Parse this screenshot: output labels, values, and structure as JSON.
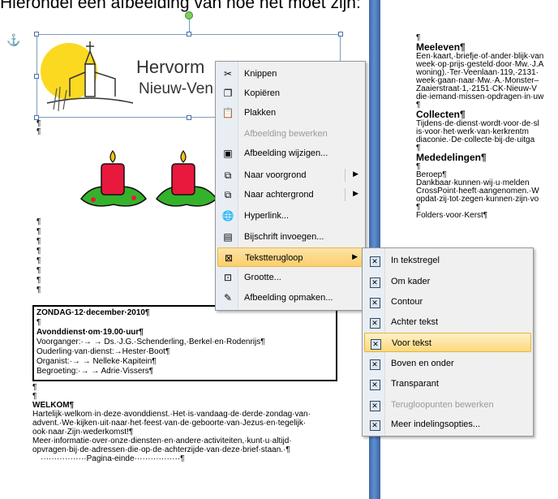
{
  "doc": {
    "title_partial": "Hierondel een afbeelding van hoe het moet zijn:",
    "logo_line1": "Hervorm",
    "logo_line2": "Nieuw-Ven",
    "pilcrow": "¶",
    "anchor": "⚓",
    "service_box": [
      "ZONDAG·12·december·2010¶",
      "¶",
      "Avonddienst·om·19.00·uur¶",
      "Voorganger:·→ → Ds.·J.G.·Schenderling,·Berkel·en·Rodenrijs¶",
      "Ouderling·van·dienst:→Hester·Boot¶",
      "Organist:·→ → Nelleke·Kapitein¶",
      "Begroeting:·→ → Adrie·Vissers¶"
    ],
    "left_body": [
      "¶",
      "¶",
      "WELKOM¶",
      "Hartelijk·welkom·in·deze·avonddienst.·Het·is·vandaag·de·derde·zondag·van·",
      "advent.·We·kijken·uit·naar·het·feest·van·de·geboorte·van·Jezus·en·tegelijk·",
      "ook·naar·Zijn·wederkomst!¶",
      "Meer·informatie·over·onze·diensten·en·andere·activiteiten,·kunt·u·altijd·",
      "opvragen·bij·de·adressen·die·op·de·achterzijde·van·deze·brief·staan.·¶",
      "·················Pagina-einde·················¶"
    ],
    "right_col": [
      {
        "t": "¶",
        "c": ""
      },
      {
        "t": "Meeleven¶",
        "c": "hd"
      },
      {
        "t": "Een·kaart,·briefje·of·ander·blijk·van",
        "c": ""
      },
      {
        "t": "week·op·prijs·gesteld·door·Mw.·J.A",
        "c": ""
      },
      {
        "t": "woning).·Ter·Veenlaan·119,·2131·",
        "c": ""
      },
      {
        "t": "week·gaan·naar·Mw.·A.·Monster–",
        "c": ""
      },
      {
        "t": "Zaaierstraat·1,·2151·CK·Nieuw-V",
        "c": ""
      },
      {
        "t": "die·iemand·missen·opdragen·in·uw",
        "c": ""
      },
      {
        "t": "¶",
        "c": ""
      },
      {
        "t": "Collecten¶",
        "c": "hd"
      },
      {
        "t": "Tijdens·de·dienst·wordt·voor·de·sl",
        "c": ""
      },
      {
        "t": "is·voor·het·werk·van·kerkrentm",
        "c": ""
      },
      {
        "t": "diaconie.·De·collecte·bij·de·uitga",
        "c": ""
      },
      {
        "t": "¶",
        "c": ""
      },
      {
        "t": "Mededelingen¶",
        "c": "hd"
      },
      {
        "t": "¶",
        "c": ""
      },
      {
        "t": "Beroep¶",
        "c": ""
      },
      {
        "t": "Dankbaar·kunnen·wij·u·melden",
        "c": ""
      },
      {
        "t": "CrossPoint·heeft·aangenomen.·W",
        "c": ""
      },
      {
        "t": "opdat·zij·tot·zegen·kunnen·zijn·vo",
        "c": ""
      },
      {
        "t": "¶",
        "c": ""
      },
      {
        "t": "Folders·voor·Kerst¶",
        "c": ""
      }
    ]
  },
  "context_menu": {
    "items": [
      {
        "label": "Knippen",
        "icon": "scissors-icon",
        "glyph": "✂",
        "disabled": false
      },
      {
        "label": "Kopiëren",
        "icon": "copy-icon",
        "glyph": "❐",
        "disabled": false
      },
      {
        "label": "Plakken",
        "icon": "paste-icon",
        "glyph": "📋",
        "disabled": false
      },
      {
        "label": "Afbeelding bewerken",
        "icon": "",
        "glyph": "",
        "disabled": true
      },
      {
        "label": "Afbeelding wijzigen...",
        "icon": "change-picture-icon",
        "glyph": "▣",
        "disabled": false
      },
      {
        "label": "Naar voorgrond",
        "icon": "bring-forward-icon",
        "glyph": "⧉",
        "disabled": false,
        "submenu": true
      },
      {
        "label": "Naar achtergrond",
        "icon": "send-backward-icon",
        "glyph": "⧉",
        "disabled": false,
        "submenu": true
      },
      {
        "label": "Hyperlink...",
        "icon": "hyperlink-icon",
        "glyph": "🌐",
        "disabled": false
      },
      {
        "label": "Bijschrift invoegen...",
        "icon": "caption-icon",
        "glyph": "▤",
        "disabled": false
      },
      {
        "label": "Tekstterugloop",
        "icon": "text-wrap-icon",
        "glyph": "⊠",
        "disabled": false,
        "submenu": true,
        "selected": true
      },
      {
        "label": "Grootte...",
        "icon": "size-icon",
        "glyph": "⊡",
        "disabled": false
      },
      {
        "label": "Afbeelding opmaken...",
        "icon": "format-picture-icon",
        "glyph": "✎",
        "disabled": false
      }
    ]
  },
  "wrap_submenu": {
    "items": [
      {
        "label": "In tekstregel",
        "icon": "inline-wrap-icon",
        "disabled": false
      },
      {
        "label": "Om kader",
        "icon": "square-wrap-icon",
        "disabled": false
      },
      {
        "label": "Contour",
        "icon": "tight-wrap-icon",
        "disabled": false
      },
      {
        "label": "Achter tekst",
        "icon": "behind-text-icon",
        "disabled": false
      },
      {
        "label": "Voor tekst",
        "icon": "in-front-of-text-icon",
        "disabled": false,
        "selected": true
      },
      {
        "label": "Boven en onder",
        "icon": "top-bottom-wrap-icon",
        "disabled": false
      },
      {
        "label": "Transparant",
        "icon": "through-wrap-icon",
        "disabled": false
      },
      {
        "label": "Terugloopunten bewerken",
        "icon": "edit-wrap-points-icon",
        "disabled": true
      },
      {
        "label": "Meer indelingsopties...",
        "icon": "layout-options-icon",
        "disabled": false
      }
    ]
  }
}
